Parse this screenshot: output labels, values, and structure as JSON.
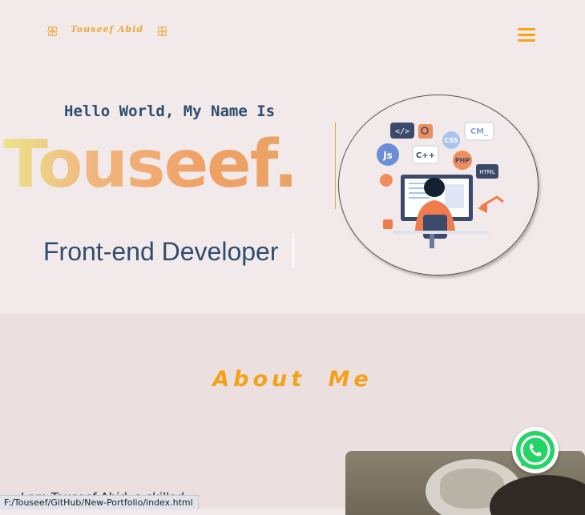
{
  "header": {
    "logo_text": "Touseef Abid",
    "logo_ornament_left": "ꕥ",
    "logo_ornament_right": "ꕥ",
    "menu_icon": "hamburger-menu-icon"
  },
  "hero": {
    "greeting": "Hello World, My Name Is",
    "name": "Touseef.",
    "role": "Front-end Developer",
    "illustration": "developer-at-computer-with-code-icons",
    "bubble_labels": [
      "</>",
      "Js",
      "C++",
      "CSS",
      "PHP",
      "HTML",
      "CM_"
    ]
  },
  "about": {
    "title": "About Me",
    "text_visible": "         I am Touseef Abid, a skilled"
  },
  "whatsapp": {
    "icon": "whatsapp-icon",
    "color": "#25d366"
  },
  "status_bar": {
    "url": "F:/Touseef/GitHub/New-Portfolio/index.html"
  },
  "colors": {
    "accent": "#f5a417",
    "text": "#2f4d6e",
    "bg": "#f2eaea",
    "section_bg": "#ebdfe0"
  }
}
